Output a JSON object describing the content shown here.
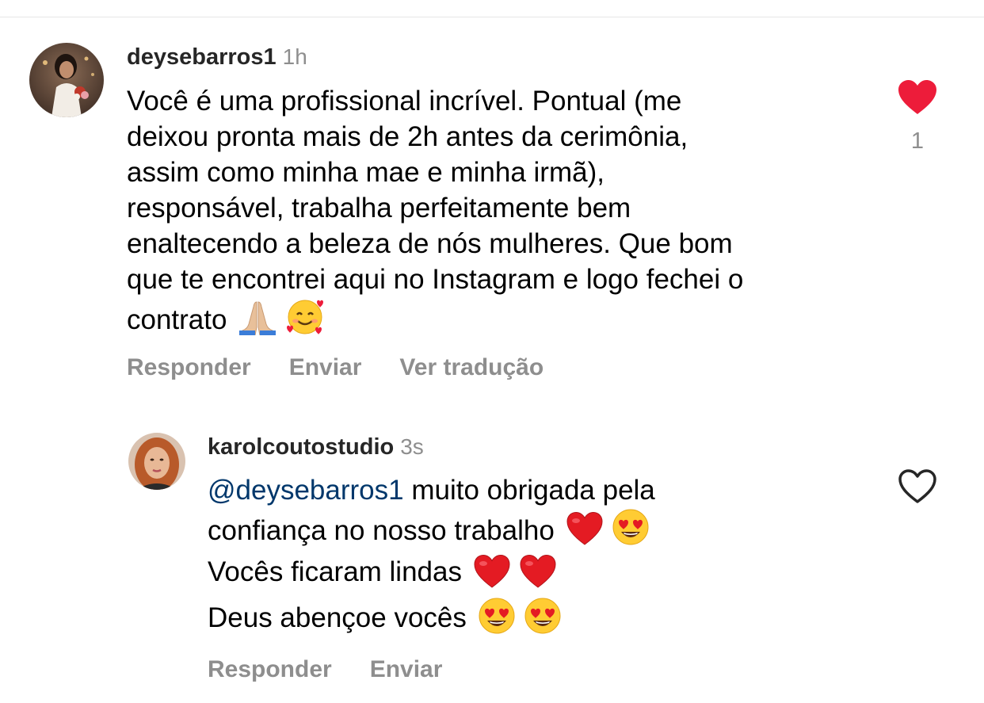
{
  "comments": [
    {
      "username": "deysebarros1",
      "timestamp": "1h",
      "lines": [
        "Você é uma profissional incrível. Pontual (me",
        "deixou pronta mais de 2h antes da cerimônia,",
        "assim como minha mae e minha irmã),",
        "responsável, trabalha perfeitamente  bem",
        "enaltecendo a beleza de nós mulheres. Que bom",
        "que te encontrei aqui no Instagram e logo fechei o",
        "contrato"
      ],
      "trailing_emojis": [
        "folded-hands",
        "smiling-face-with-hearts"
      ],
      "liked": true,
      "like_count": "1",
      "actions": {
        "reply": "Responder",
        "send": "Enviar",
        "translate": "Ver tradução"
      },
      "colors": {
        "like": "#ed1c3a"
      }
    },
    {
      "username": "karolcoutostudio",
      "timestamp": "3s",
      "mention": "@deysebarros1",
      "lines": [
        "muito obrigada pela",
        "confiança no nosso trabalho",
        "Vocês ficaram lindas",
        "Deus abençoe vocês"
      ],
      "line_emojis": [
        [],
        [
          "red-heart",
          "heart-eyes"
        ],
        [
          "red-heart",
          "red-heart"
        ],
        [
          "heart-eyes",
          "heart-eyes"
        ]
      ],
      "liked": false,
      "actions": {
        "reply": "Responder",
        "send": "Enviar"
      },
      "colors": {
        "mention": "#00376b"
      }
    }
  ],
  "theme": {
    "muted_text": "#8e8e8e",
    "username_text": "#262626",
    "background": "#ffffff"
  }
}
